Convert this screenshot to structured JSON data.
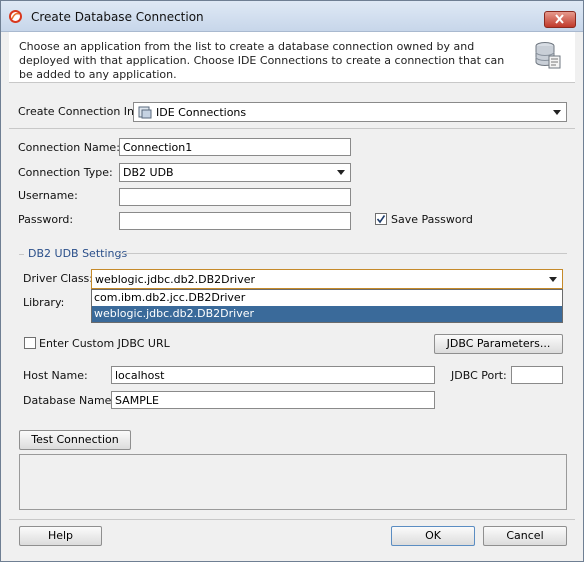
{
  "window": {
    "title": "Create Database Connection"
  },
  "header": {
    "intro_text": "Choose an application from the list to create a database connection owned by and deployed with that application. Choose IDE Connections to create a connection that can be added to any application."
  },
  "form": {
    "create_in_label": "Create Connection In:",
    "create_in_value": "IDE Connections",
    "connection_name_label": "Connection Name:",
    "connection_name_value": "Connection1",
    "connection_type_label": "Connection Type:",
    "connection_type_value": "DB2 UDB",
    "username_label": "Username:",
    "username_value": "",
    "password_label": "Password:",
    "password_value": "",
    "save_password_label": "Save Password",
    "save_password_checked": true
  },
  "settings": {
    "group_title": "DB2 UDB Settings",
    "driver_class_label": "Driver Class:",
    "driver_class_value": "weblogic.jdbc.db2.DB2Driver",
    "driver_options": [
      "com.ibm.db2.jcc.DB2Driver",
      "weblogic.jdbc.db2.DB2Driver"
    ],
    "library_label": "Library:",
    "custom_url_label": "Enter Custom JDBC URL",
    "jdbc_parameters_label": "JDBC Parameters...",
    "host_name_label": "Host Name:",
    "host_name_value": "localhost",
    "jdbc_port_label": "JDBC Port:",
    "jdbc_port_value": "",
    "database_name_label": "Database Name:",
    "database_name_value": "SAMPLE"
  },
  "actions": {
    "test_connection": "Test Connection",
    "help": "Help",
    "ok": "OK",
    "cancel": "Cancel"
  }
}
